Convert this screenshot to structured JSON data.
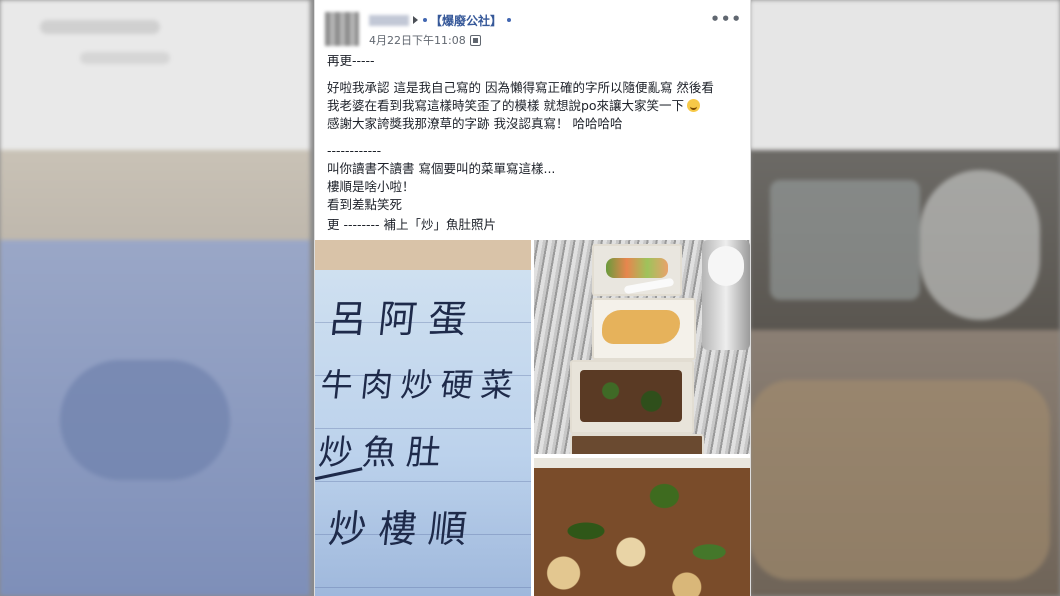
{
  "post": {
    "author_name": "",
    "page_name": "【爆廢公社】",
    "timestamp": "4月22日下午11:08",
    "more_label": "•••",
    "body": [
      "再更-----",
      "",
      "好啦我承認 這是我自己寫的 因為懶得寫正確的字所以隨便亂寫 然後看",
      "我老婆在看到我寫這樣時笑歪了的模樣 就想說po來讓大家笑一下",
      "感謝大家誇獎我那潦草的字跡 我沒認真寫！ 哈哈哈哈",
      "",
      "------------",
      "叫你讀書不讀書 寫個要叫的菜單寫這樣...",
      "樓順是啥小啦！",
      "看到差點笑死",
      "更 -------- 補上「炒」魚肚照片"
    ]
  },
  "photos": {
    "note_lines": [
      "呂阿蛋",
      "牛肉炒硬菜",
      "炒魚肚",
      "炒樓順"
    ]
  },
  "colors": {
    "page_link": "#365899",
    "text": "#1d2129",
    "meta": "#616770"
  },
  "icons": {
    "more": "more-horizontal-icon",
    "privacy": "globe-icon",
    "emoji": "smile-emoji-icon"
  }
}
